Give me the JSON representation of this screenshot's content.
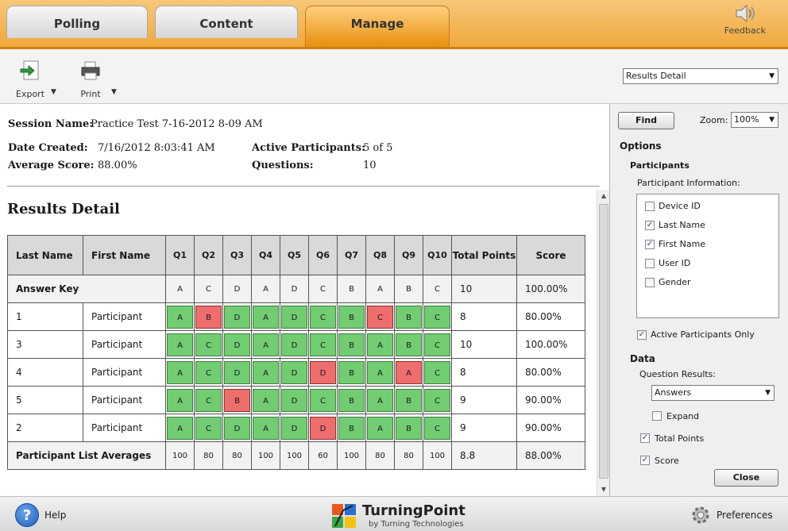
{
  "tabs": [
    {
      "label": "Polling",
      "active": false
    },
    {
      "label": "Content",
      "active": false
    },
    {
      "label": "Manage",
      "active": true
    }
  ],
  "feedback": {
    "label": "Feedback",
    "icon": "speaker-icon"
  },
  "toolbar": {
    "export_label": "Export",
    "print_label": "Print",
    "view_select": "Results Detail"
  },
  "session": {
    "name_label": "Session Name:",
    "name": "Practice Test 7-16-2012 8-09 AM",
    "date_label": "Date Created:",
    "date": "7/16/2012 8:03:41 AM",
    "avg_label": "Average Score:",
    "avg": "88.00%",
    "active_label": "Active Participants:",
    "active": "5 of 5",
    "questions_label": "Questions:",
    "questions": "10"
  },
  "report_title": "Results Detail",
  "table": {
    "headers": {
      "last_name": "Last Name",
      "first_name": "First Name",
      "questions": [
        "Q1",
        "Q2",
        "Q3",
        "Q4",
        "Q5",
        "Q6",
        "Q7",
        "Q8",
        "Q9",
        "Q10"
      ],
      "total_points": "Total Points",
      "score": "Score"
    },
    "answer_key": {
      "label": "Answer Key",
      "answers": [
        "A",
        "C",
        "D",
        "A",
        "D",
        "C",
        "B",
        "A",
        "B",
        "C"
      ],
      "total": "10",
      "score": "100.00%"
    },
    "rows": [
      {
        "last": "1",
        "first": "Participant",
        "answers": [
          "A",
          "B",
          "D",
          "A",
          "D",
          "C",
          "B",
          "C",
          "B",
          "C"
        ],
        "correct": [
          true,
          false,
          true,
          true,
          true,
          true,
          true,
          false,
          true,
          true
        ],
        "total": "8",
        "score": "80.00%"
      },
      {
        "last": "3",
        "first": "Participant",
        "answers": [
          "A",
          "C",
          "D",
          "A",
          "D",
          "C",
          "B",
          "A",
          "B",
          "C"
        ],
        "correct": [
          true,
          true,
          true,
          true,
          true,
          true,
          true,
          true,
          true,
          true
        ],
        "total": "10",
        "score": "100.00%"
      },
      {
        "last": "4",
        "first": "Participant",
        "answers": [
          "A",
          "C",
          "D",
          "A",
          "D",
          "D",
          "B",
          "A",
          "A",
          "C"
        ],
        "correct": [
          true,
          true,
          true,
          true,
          true,
          false,
          true,
          true,
          false,
          true
        ],
        "total": "8",
        "score": "80.00%"
      },
      {
        "last": "5",
        "first": "Participant",
        "answers": [
          "A",
          "C",
          "B",
          "A",
          "D",
          "C",
          "B",
          "A",
          "B",
          "C"
        ],
        "correct": [
          true,
          true,
          false,
          true,
          true,
          true,
          true,
          true,
          true,
          true
        ],
        "total": "9",
        "score": "90.00%"
      },
      {
        "last": "2",
        "first": "Participant",
        "answers": [
          "A",
          "C",
          "D",
          "A",
          "D",
          "D",
          "B",
          "A",
          "B",
          "C"
        ],
        "correct": [
          true,
          true,
          true,
          true,
          true,
          false,
          true,
          true,
          true,
          true
        ],
        "total": "9",
        "score": "90.00%"
      }
    ],
    "averages": {
      "label": "Participant List Averages",
      "values": [
        "100",
        "80",
        "80",
        "100",
        "100",
        "60",
        "100",
        "80",
        "80",
        "100"
      ],
      "total": "8.8",
      "score": "88.00%"
    }
  },
  "panel": {
    "find_label": "Find",
    "zoom_label": "Zoom:",
    "zoom_value": "100%",
    "options_heading": "Options",
    "participants_heading": "Participants",
    "participant_info_label": "Participant Information:",
    "participant_fields": [
      {
        "label": "Device ID",
        "checked": false
      },
      {
        "label": "Last Name",
        "checked": true
      },
      {
        "label": "First Name",
        "checked": true
      },
      {
        "label": "User ID",
        "checked": false
      },
      {
        "label": "Gender",
        "checked": false
      }
    ],
    "active_only": {
      "label": "Active Participants Only",
      "checked": true
    },
    "data_heading": "Data",
    "question_results_label": "Question Results:",
    "question_results_value": "Answers",
    "expand": {
      "label": "Expand",
      "checked": false
    },
    "total_points": {
      "label": "Total Points",
      "checked": true
    },
    "score": {
      "label": "Score",
      "checked": true
    },
    "close_label": "Close"
  },
  "footer": {
    "help_label": "Help",
    "brand_name": "TurningPoint",
    "brand_sub": "by Turning Technologies",
    "prefs_label": "Preferences"
  },
  "colors": {
    "correct": "#72cc72",
    "incorrect": "#ee6d6d",
    "accent": "#f0a83c"
  }
}
